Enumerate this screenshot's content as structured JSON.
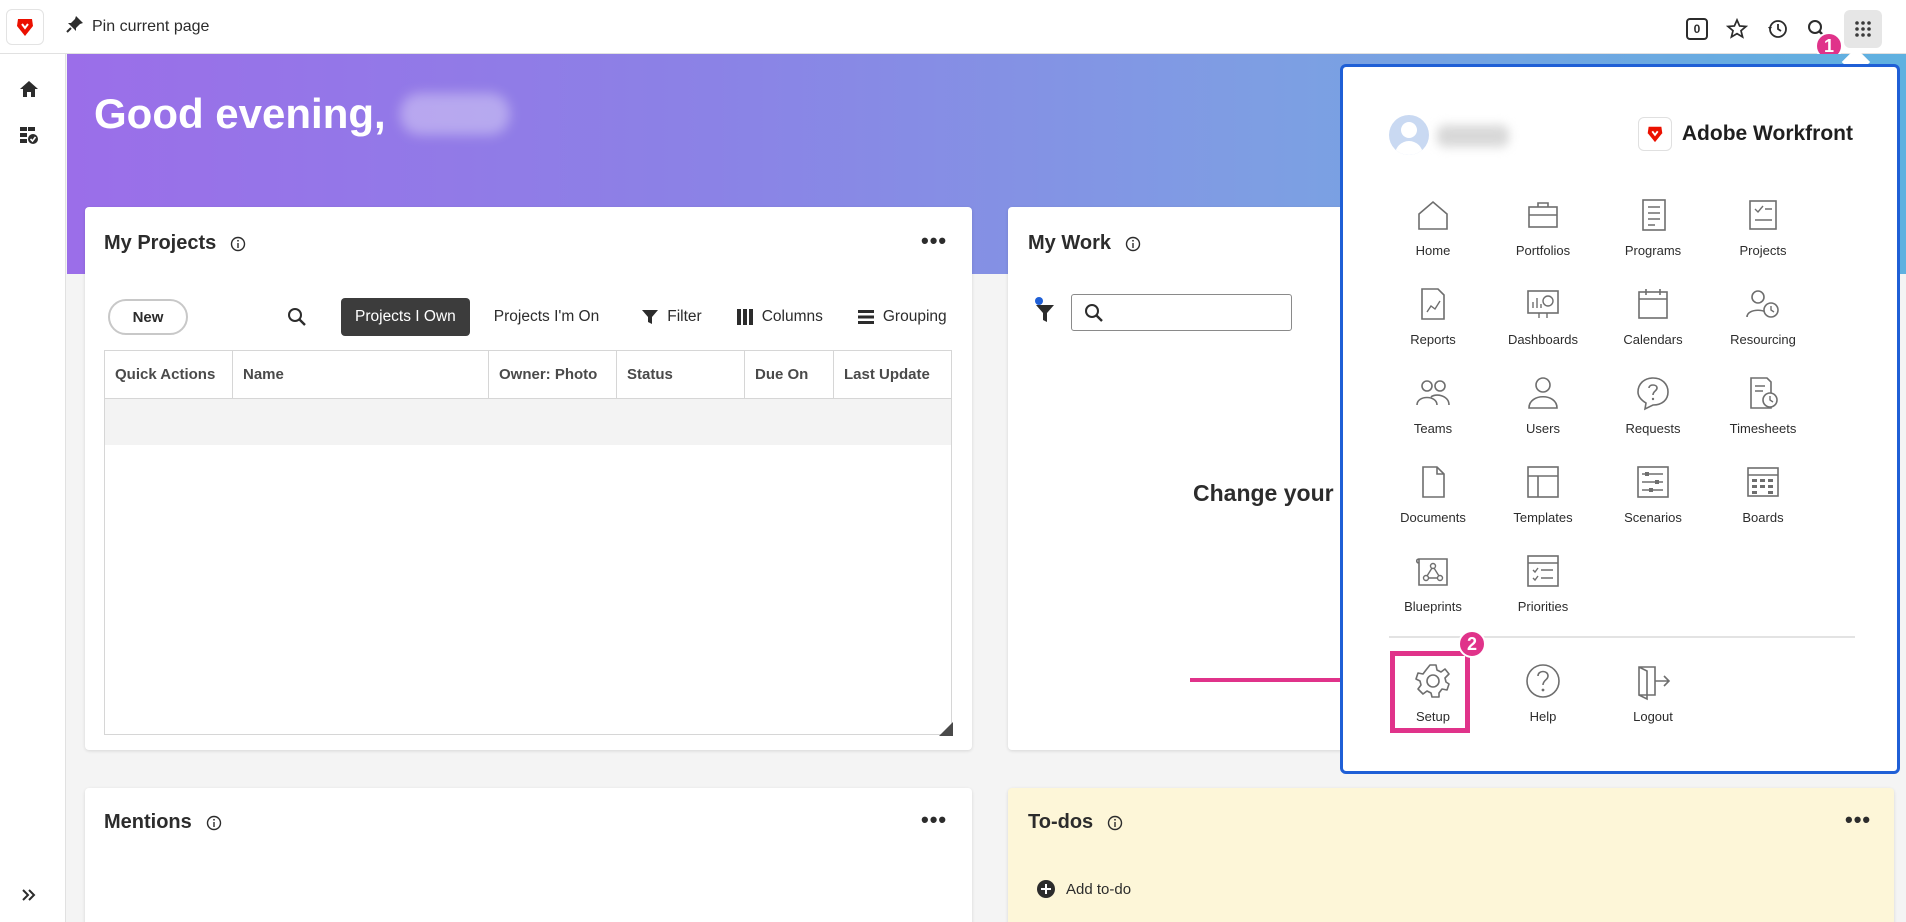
{
  "topbar": {
    "pin_label": "Pin current page",
    "notification_count": "0"
  },
  "steps": {
    "one": "1",
    "two": "2"
  },
  "hero": {
    "greeting": "Good evening,"
  },
  "my_projects": {
    "title": "My Projects",
    "new_label": "New",
    "tabs": [
      "Projects I Own",
      "Projects I'm On"
    ],
    "filter_label": "Filter",
    "columns_label": "Columns",
    "grouping_label": "Grouping",
    "headers": [
      "Quick Actions",
      "Name",
      "Owner: Photo",
      "Status",
      "Due On",
      "Last Update"
    ]
  },
  "my_work": {
    "title": "My Work",
    "message": "Change your f"
  },
  "mentions": {
    "title": "Mentions"
  },
  "todos": {
    "title": "To-dos",
    "add_label": "Add to-do"
  },
  "apps_menu": {
    "brand": "Adobe Workfront",
    "apps": [
      {
        "label": "Home",
        "icon": "home-icon"
      },
      {
        "label": "Portfolios",
        "icon": "briefcase-icon"
      },
      {
        "label": "Programs",
        "icon": "programs-icon"
      },
      {
        "label": "Projects",
        "icon": "projects-icon"
      },
      {
        "label": "Reports",
        "icon": "reports-icon"
      },
      {
        "label": "Dashboards",
        "icon": "dashboards-icon"
      },
      {
        "label": "Calendars",
        "icon": "calendar-icon"
      },
      {
        "label": "Resourcing",
        "icon": "resourcing-icon"
      },
      {
        "label": "Teams",
        "icon": "teams-icon"
      },
      {
        "label": "Users",
        "icon": "user-icon"
      },
      {
        "label": "Requests",
        "icon": "requests-icon"
      },
      {
        "label": "Timesheets",
        "icon": "timesheets-icon"
      },
      {
        "label": "Documents",
        "icon": "document-icon"
      },
      {
        "label": "Templates",
        "icon": "templates-icon"
      },
      {
        "label": "Scenarios",
        "icon": "scenarios-icon"
      },
      {
        "label": "Boards",
        "icon": "boards-icon"
      },
      {
        "label": "Blueprints",
        "icon": "blueprints-icon"
      },
      {
        "label": "Priorities",
        "icon": "priorities-icon"
      }
    ],
    "bottom": [
      {
        "label": "Setup",
        "icon": "gear-icon"
      },
      {
        "label": "Help",
        "icon": "help-icon"
      },
      {
        "label": "Logout",
        "icon": "logout-icon"
      }
    ]
  },
  "colors": {
    "accent_pink": "#e0338a",
    "popover_border": "#1f5fd6",
    "brand_red": "#eb1000"
  }
}
